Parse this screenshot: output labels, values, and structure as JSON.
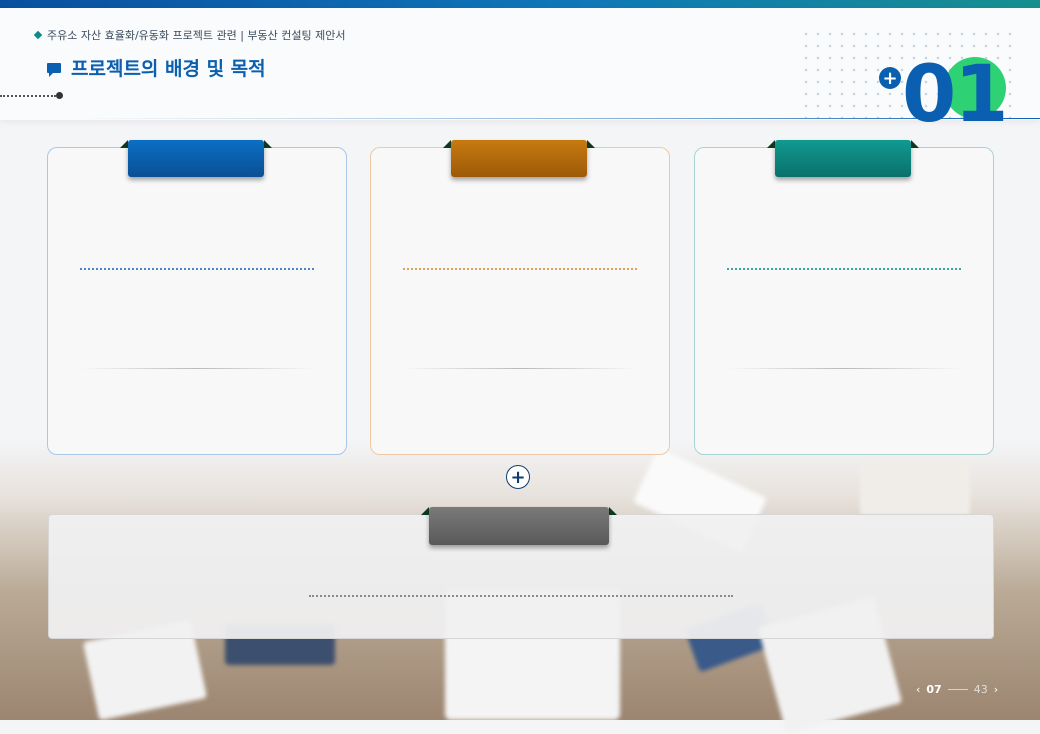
{
  "header": {
    "breadcrumb": "주유소 자산 효율화/유동화 프로젝트 관련 | 부동산 컨설팅 제안서",
    "title": "프로젝트의 배경 및 목적",
    "subtitle": "",
    "section_number": "01"
  },
  "cards": [
    {
      "tab_label": "",
      "lines_top": [
        "",
        ""
      ],
      "lines_mid": [
        "",
        ""
      ],
      "lines_bottom": [
        "",
        "",
        ""
      ],
      "accent": "#0b5fb0"
    },
    {
      "tab_label": "",
      "lines_top": [
        "",
        ""
      ],
      "lines_mid": [
        "",
        ""
      ],
      "lines_bottom": [
        "",
        "",
        ""
      ],
      "accent": "#c77a10"
    },
    {
      "tab_label": "",
      "lines_top": [
        "",
        ""
      ],
      "lines_mid": [
        "",
        ""
      ],
      "lines_bottom": [
        "",
        ""
      ],
      "accent": "#109a91"
    }
  ],
  "bottom_box": {
    "tab_label": "",
    "line1": "",
    "line2": ""
  },
  "pager": {
    "current": "07",
    "total": "43"
  },
  "icons": {
    "plus": "plus-circle-icon",
    "prev": "chevron-left-icon",
    "next": "chevron-right-icon",
    "title": "speech-bubble-icon"
  }
}
